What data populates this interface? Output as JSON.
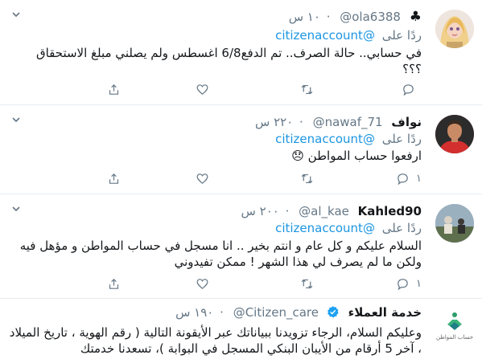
{
  "tweets": [
    {
      "name": "",
      "badge": "♣",
      "handle": "@ola6388",
      "time": "١٠ س",
      "reply_prefix": "ردًا على",
      "reply_to": "@citizenaccount",
      "text": "في حسابي.. حالة الصرف.. تم الدفع6/8 اغسطس ولم يصلني مبلغ الاستحقاق\n؟؟؟",
      "reply_count": "",
      "retweet_count": "",
      "like_count": ""
    },
    {
      "name": "نواف",
      "handle": "@nawaf_71",
      "time": "٢٢٠ س",
      "reply_prefix": "ردًا على",
      "reply_to": "@citizenaccount",
      "text": "ارفعوا حساب المواطن 😞",
      "reply_count": "١",
      "retweet_count": "",
      "like_count": ""
    },
    {
      "name": "Kahled90",
      "handle": "@al_kae",
      "time": "٢٠٠ س",
      "reply_prefix": "ردًا على",
      "reply_to": "@citizenaccount",
      "text": "السلام عليكم و كل عام و انتم بخير .. انا مسجل في حساب المواطن و مؤهل فيه\nولكن ما لم يصرف لي هذا الشهر !  ممكن تفيدوني",
      "reply_count": "١",
      "retweet_count": "",
      "like_count": ""
    },
    {
      "name": "خدمة العملاء",
      "handle": "@Citizen_care",
      "time": "١٩٠ س",
      "avatar_caption": "حساب المواطن",
      "text": "وعليكم السلام، الرجاء تزويدنا ببياناتك عبر الأيقونة التالية ( رقم الهوية ، تاريخ الميلاد\n، آخر 5 أرقام من الأيبان البنكي المسجل في البوابة )، تسعدنا خدمتك"
    }
  ],
  "colors": {
    "link": "#1b95e0",
    "muted": "#657786",
    "divider": "#e6ecf0",
    "verified": "#1da1f2"
  }
}
